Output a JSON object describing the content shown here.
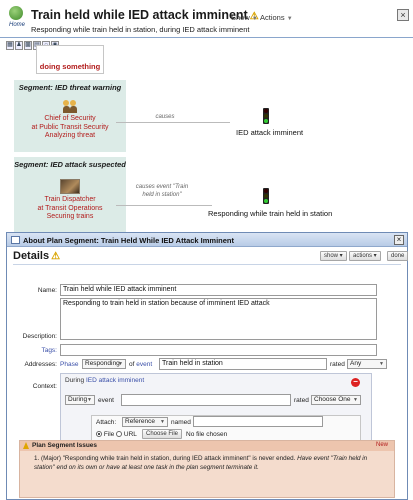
{
  "header": {
    "home_label": "Home",
    "title": "Train held while IED attack imminent",
    "show_menu": "Show",
    "actions_menu": "Actions",
    "subtitle": "Responding while train held in station, during IED attack imminent"
  },
  "flow": {
    "start_node": "doing something",
    "segments": [
      {
        "title": "Segment: IED threat warning",
        "actor_lines": [
          "Chief of Security",
          "at Public Transit Security",
          "Analyzing threat"
        ],
        "edge_label": "causes",
        "target": "IED attack imminent"
      },
      {
        "title": "Segment: IED attack suspected",
        "actor_lines": [
          "Train Dispatcher",
          "at Transit Operations",
          "Securing trains"
        ],
        "edge_label_lines": [
          "causes event \"Train",
          "held in station\""
        ],
        "target": "Responding while train held in station"
      }
    ]
  },
  "modal": {
    "title": "About Plan Segment: Train Held While IED Attack Imminent",
    "heading": "Details",
    "show_btn": "show",
    "actions_btn": "actions",
    "done_btn": "done",
    "name_label": "Name:",
    "name_value": "Train held while IED attack imminent",
    "description_label": "Description:",
    "description_value": "Responding to train held in station because of imminent IED attack",
    "tags_label": "Tags:",
    "addresses_label": "Addresses:",
    "phase_word": "Phase",
    "phase_value": "Responding",
    "of_event_of": "of",
    "of_event_word": "event",
    "event_value": "Train held in station",
    "rated_label": "rated",
    "rated_value": "Any",
    "context_label": "Context:",
    "context_during": "During",
    "context_event_link": "IED attack imminent",
    "ctx_sel_value": "During",
    "ctx_event_word": "event",
    "ctx_rated_label": "rated",
    "ctx_rated_value": "Choose One",
    "attach_label": "Attach:",
    "attach_type": "Reference",
    "attach_named": "named",
    "file_label": "File",
    "url_label": "URL",
    "choose_file": "Choose File",
    "no_file": "No file chosen",
    "issues_title": "Plan Segment Issues",
    "issues_new": "New",
    "issue_text_main": "1. (Major) \"Responding while train held in station, during IED attack imminent\" is never ended.",
    "issue_text_hint": "Have event \"Train held in station\" end on its own or have at least one task in the plan segment terminate it."
  },
  "colors": {
    "actor_red": "#b21c1c",
    "segment_bg": "#dcebe7",
    "link_blue": "#3a4fa8",
    "issue_bg": "#f4dccd"
  }
}
